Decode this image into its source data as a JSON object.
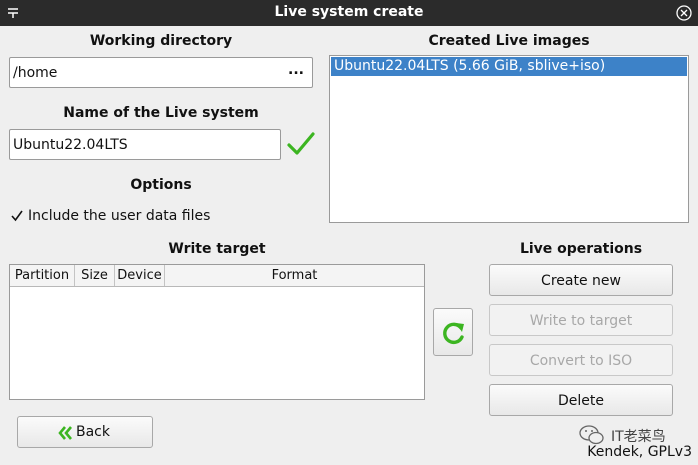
{
  "window": {
    "title": "Live system create"
  },
  "working_directory": {
    "heading": "Working directory",
    "value": "/home",
    "browse_label": "..."
  },
  "live_name": {
    "heading": "Name of the Live system",
    "value": "Ubuntu22.04LTS"
  },
  "options": {
    "heading": "Options",
    "include_user_data": {
      "label": "Include the user data files",
      "checked": true
    }
  },
  "created_images": {
    "heading": "Created Live images",
    "items": [
      "Ubuntu22.04LTS (5.66 GiB, sblive+iso)"
    ]
  },
  "write_target": {
    "heading": "Write target",
    "columns": [
      "Partition",
      "Size",
      "Device",
      "Format"
    ]
  },
  "live_operations": {
    "heading": "Live operations",
    "create_new": "Create new",
    "write_to_target": "Write to target",
    "convert_to_iso": "Convert to ISO",
    "delete": "Delete"
  },
  "back_label": "Back",
  "watermark": "IT老菜鸟",
  "footer": "Kendek, GPLv3",
  "colors": {
    "accent_green": "#3cb521",
    "selection_blue": "#3d82c8",
    "titlebar": "#2b2b2b"
  }
}
